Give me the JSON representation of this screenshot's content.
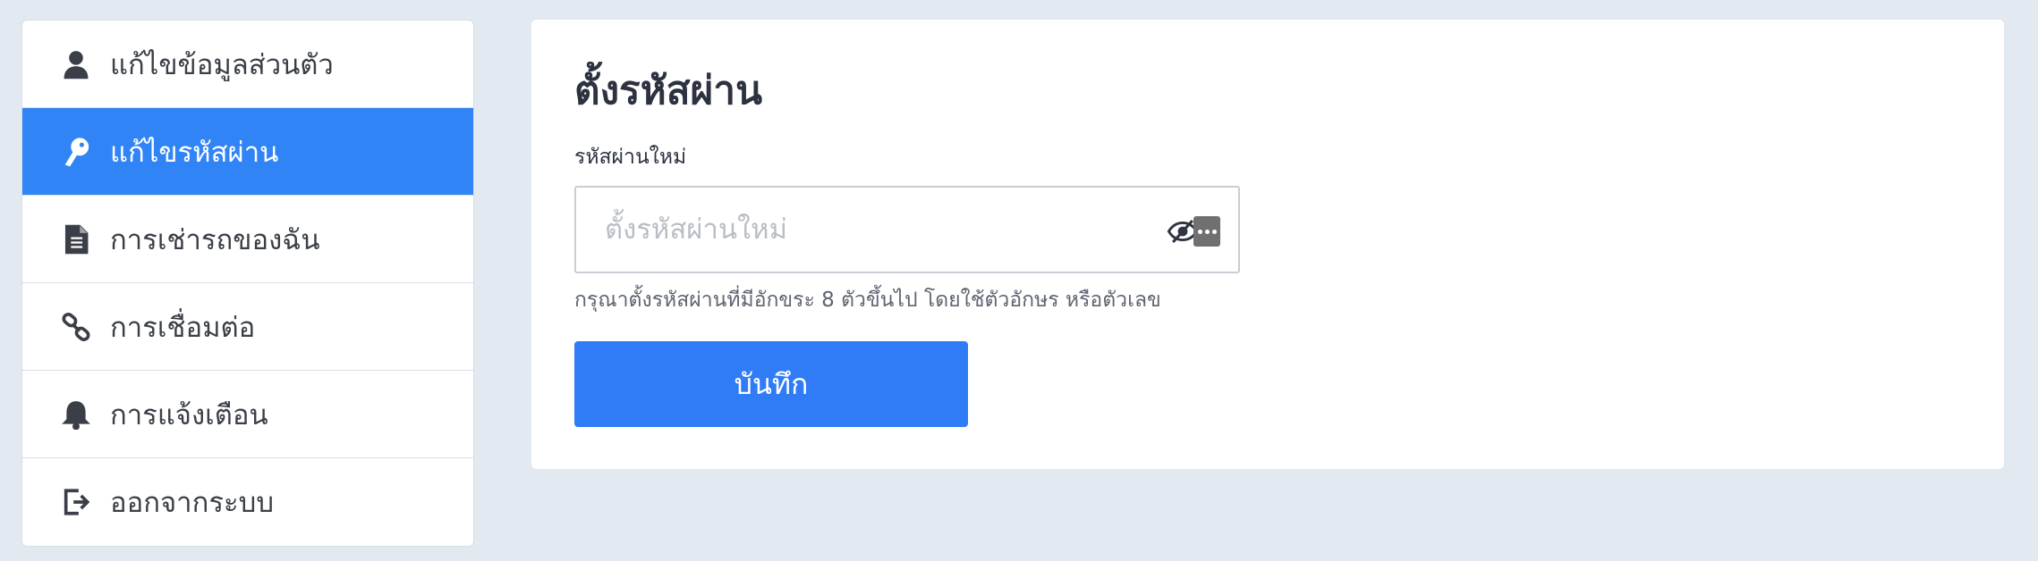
{
  "sidebar": {
    "items": [
      {
        "label": "แก้ไขข้อมูลส่วนตัว",
        "icon": "user-icon",
        "active": false
      },
      {
        "label": "แก้ไขรหัสผ่าน",
        "icon": "key-icon",
        "active": true
      },
      {
        "label": "การเช่ารถของฉัน",
        "icon": "document-icon",
        "active": false
      },
      {
        "label": "การเชื่อมต่อ",
        "icon": "link-icon",
        "active": false
      },
      {
        "label": "การแจ้งเตือน",
        "icon": "bell-icon",
        "active": false
      },
      {
        "label": "ออกจากระบบ",
        "icon": "sign-out-icon",
        "active": false
      }
    ]
  },
  "main": {
    "title": "ตั้งรหัสผ่าน",
    "field_label": "รหัสผ่านใหม่",
    "password_placeholder": "ตั้งรหัสผ่านใหม่",
    "password_value": "",
    "helper_text": "กรุณาตั้งรหัสผ่านที่มีอักขระ 8 ตัวขึ้นไป โดยใช้ตัวอักษร หรือตัวเลข",
    "save_label": "บันทึก"
  },
  "colors": {
    "background": "#e3e9f1",
    "accent": "#3184f5",
    "button": "#2f7cf6",
    "text": "#2c3240"
  }
}
